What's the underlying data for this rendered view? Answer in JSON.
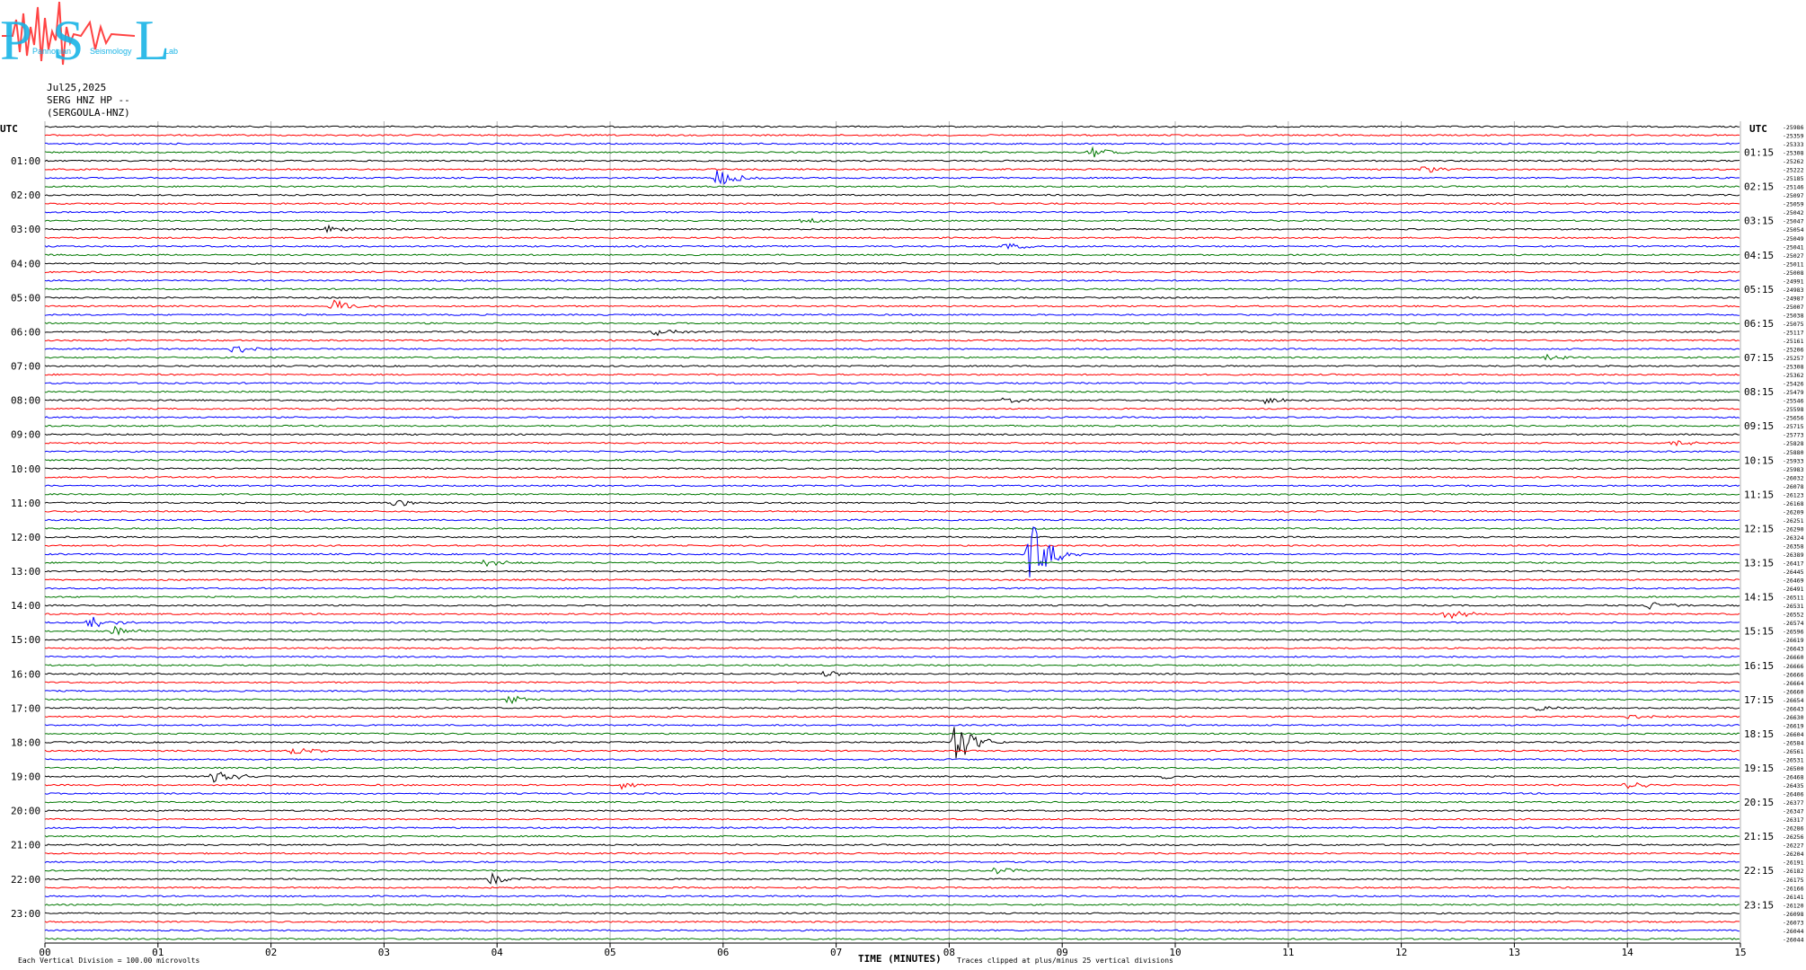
{
  "logo": {
    "letters": [
      "P",
      "S",
      "L"
    ],
    "words": [
      "Pannonian",
      "Seismology",
      "Lab"
    ]
  },
  "header": {
    "date": "Jul25,2025",
    "station": "SERG HNZ HP --",
    "station_full": "(SERGOULA-HNZ)"
  },
  "chart_data": {
    "type": "helicorder",
    "utc_label": "UTC",
    "xlabel": "TIME (MINUTES)",
    "xlim": [
      0,
      15
    ],
    "x_ticks": [
      "00",
      "01",
      "02",
      "03",
      "04",
      "05",
      "06",
      "07",
      "08",
      "09",
      "10",
      "11",
      "12",
      "13",
      "14",
      "15"
    ],
    "left_hour_labels": [
      "01:00",
      "02:00",
      "03:00",
      "04:00",
      "05:00",
      "06:00",
      "07:00",
      "08:00",
      "09:00",
      "10:00",
      "11:00",
      "12:00",
      "13:00",
      "14:00",
      "15:00",
      "16:00",
      "17:00",
      "18:00",
      "19:00",
      "20:00",
      "21:00",
      "22:00",
      "23:00"
    ],
    "right_hour_labels": [
      "01:15",
      "02:15",
      "03:15",
      "04:15",
      "05:15",
      "06:15",
      "07:15",
      "08:15",
      "09:15",
      "10:15",
      "11:15",
      "12:15",
      "13:15",
      "14:15",
      "15:15",
      "16:15",
      "17:15",
      "18:15",
      "19:15",
      "20:15",
      "21:15",
      "22:15",
      "23:15"
    ],
    "trace_colors": [
      "#000000",
      "#ff0000",
      "#0000ff",
      "#007700"
    ],
    "traces_per_hour": 4,
    "trace_count": 96,
    "trace_offsets": [
      "-25986",
      "-25359",
      "-25333",
      "-25308",
      "-25262",
      "-25222",
      "-25185",
      "-25146",
      "-25097",
      "-25059",
      "-25042",
      "-25047",
      "-25054",
      "-25049",
      "-25041",
      "-25027",
      "-25011",
      "-25008",
      "-24991",
      "-24983",
      "-24987",
      "-25007",
      "-25038",
      "-25075",
      "-25117",
      "-25161",
      "-25206",
      "-25257",
      "-25308",
      "-25362",
      "-25426",
      "-25479",
      "-25546",
      "-25598",
      "-25656",
      "-25715",
      "-25773",
      "-25828",
      "-25880",
      "-25933",
      "-25983",
      "-26032",
      "-26078",
      "-26123",
      "-26168",
      "-26209",
      "-26251",
      "-26290",
      "-26324",
      "-26358",
      "-26389",
      "-26417",
      "-26445",
      "-26469",
      "-26491",
      "-26511",
      "-26531",
      "-26552",
      "-26574",
      "-26596",
      "-26619",
      "-26643",
      "-26660",
      "-26666",
      "-26666",
      "-26664",
      "-26660",
      "-26654",
      "-26643",
      "-26630",
      "-26619",
      "-26604",
      "-26584",
      "-26561",
      "-26531",
      "-26500",
      "-26468",
      "-26435",
      "-26406",
      "-26377",
      "-26347",
      "-26317",
      "-26286",
      "-26256",
      "-26227",
      "-26204",
      "-26191",
      "-26182",
      "-26175",
      "-26166",
      "-26141",
      "-26120",
      "-26098",
      "-26073",
      "-26044",
      "-26044"
    ],
    "events": [
      {
        "trace": 6,
        "minute": 5.95,
        "amp": 1.2
      },
      {
        "trace": 3,
        "minute": 9.25,
        "amp": 0.8
      },
      {
        "trace": 5,
        "minute": 12.2,
        "amp": 0.5
      },
      {
        "trace": 11,
        "minute": 6.7,
        "amp": 0.6
      },
      {
        "trace": 12,
        "minute": 2.5,
        "amp": 0.6
      },
      {
        "trace": 14,
        "minute": 8.5,
        "amp": 0.5
      },
      {
        "trace": 21,
        "minute": 2.55,
        "amp": 1.0
      },
      {
        "trace": 24,
        "minute": 5.4,
        "amp": 0.6
      },
      {
        "trace": 26,
        "minute": 1.65,
        "amp": 1.0
      },
      {
        "trace": 27,
        "minute": 13.3,
        "amp": 0.5
      },
      {
        "trace": 32,
        "minute": 8.5,
        "amp": 0.5
      },
      {
        "trace": 32,
        "minute": 10.8,
        "amp": 0.5
      },
      {
        "trace": 37,
        "minute": 14.4,
        "amp": 0.7
      },
      {
        "trace": 44,
        "minute": 3.1,
        "amp": 0.5
      },
      {
        "trace": 50,
        "minute": 8.72,
        "amp": 4.5
      },
      {
        "trace": 51,
        "minute": 3.9,
        "amp": 0.6
      },
      {
        "trace": 56,
        "minute": 14.2,
        "amp": 0.7
      },
      {
        "trace": 57,
        "minute": 12.4,
        "amp": 0.8
      },
      {
        "trace": 58,
        "minute": 0.4,
        "amp": 0.9
      },
      {
        "trace": 59,
        "minute": 0.6,
        "amp": 0.7
      },
      {
        "trace": 64,
        "minute": 6.9,
        "amp": 0.5
      },
      {
        "trace": 67,
        "minute": 4.1,
        "amp": 0.6
      },
      {
        "trace": 68,
        "minute": 13.2,
        "amp": 0.5
      },
      {
        "trace": 69,
        "minute": 14.0,
        "amp": 0.6
      },
      {
        "trace": 72,
        "minute": 8.05,
        "amp": 3.0
      },
      {
        "trace": 73,
        "minute": 2.2,
        "amp": 0.6
      },
      {
        "trace": 76,
        "minute": 1.5,
        "amp": 1.8
      },
      {
        "trace": 76,
        "minute": 9.9,
        "amp": 0.4
      },
      {
        "trace": 77,
        "minute": 14.0,
        "amp": 0.7
      },
      {
        "trace": 77,
        "minute": 5.1,
        "amp": 0.5
      },
      {
        "trace": 87,
        "minute": 8.4,
        "amp": 0.5
      },
      {
        "trace": 88,
        "minute": 3.95,
        "amp": 0.8
      }
    ],
    "footer_left": "Each Vertical Division =  100.00 microvolts",
    "footer_mid": "Traces clipped at plus/minus 25 vertical divisions"
  }
}
